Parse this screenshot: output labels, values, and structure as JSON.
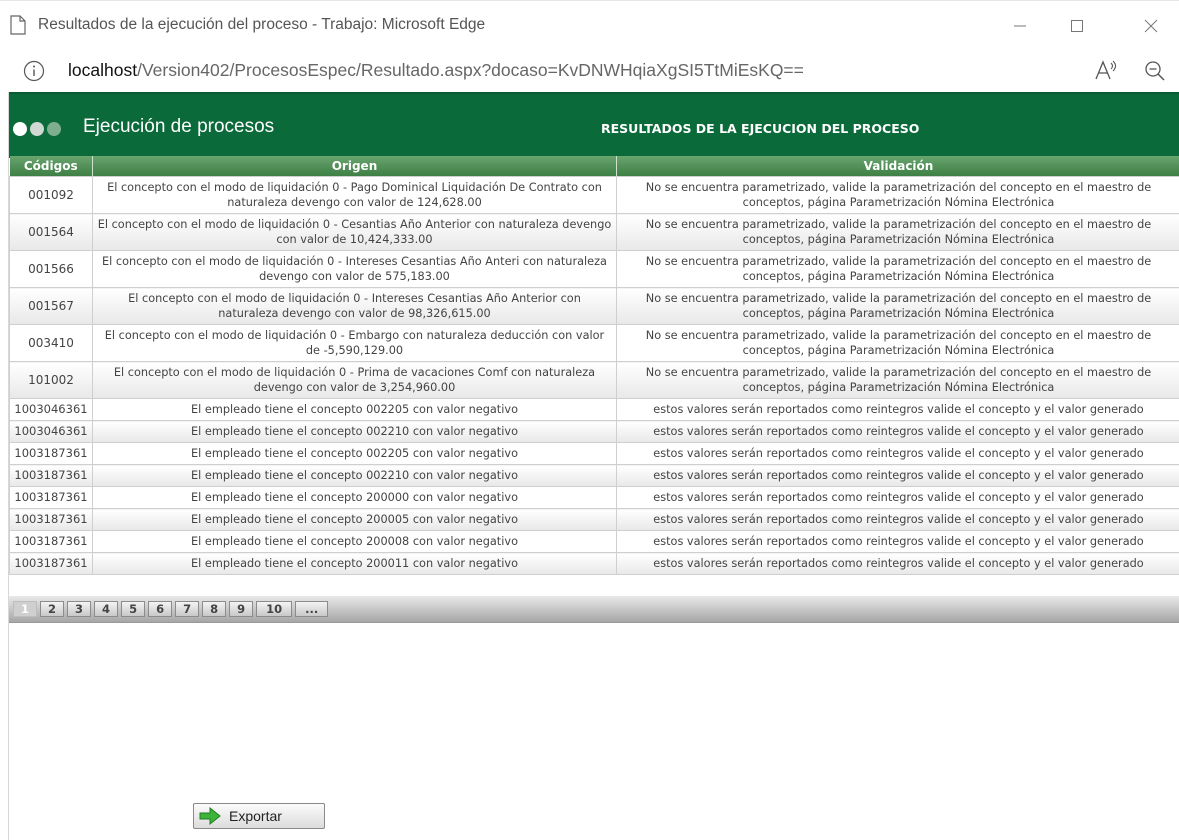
{
  "window": {
    "title": "Resultados de la ejecución del proceso - Trabajo: Microsoft Edge",
    "url_host": "localhost",
    "url_path": "/Version402/ProcesosEspec/Resultado.aspx?docaso=KvDNWHqiaXgSI5TtMiEsKQ=="
  },
  "icons": {
    "page": "page-icon",
    "minimize": "minimize-icon",
    "maximize": "maximize-icon",
    "close": "close-icon",
    "info": "info-icon",
    "read_aloud": "read-aloud-icon",
    "zoom_out": "zoom-out-icon",
    "export": "arrow-right-icon"
  },
  "colors": {
    "header_green": "#0a6a3a",
    "dot_1": "#ffffff",
    "dot_2": "#cfd8d2",
    "dot_3": "#7fae8f"
  },
  "header": {
    "brand": "Ejecución de procesos",
    "heading": "RESULTADOS DE LA EJECUCION DEL PROCESO"
  },
  "table": {
    "columns": [
      "Códigos",
      "Origen",
      "Validación"
    ],
    "rows": [
      {
        "code": "001092",
        "origen": "El concepto con el modo de liquidación 0 - Pago Dominical Liquidación De Contrato con naturaleza devengo con valor de 124,628.00",
        "validacion": "No se encuentra parametrizado, valide la parametrización del concepto en el maestro de conceptos, página Parametrización Nómina Electrónica"
      },
      {
        "code": "001564",
        "origen": "El concepto con el modo de liquidación 0 - Cesantias Año Anterior con naturaleza devengo con valor de 10,424,333.00",
        "validacion": "No se encuentra parametrizado, valide la parametrización del concepto en el maestro de conceptos, página Parametrización Nómina Electrónica"
      },
      {
        "code": "001566",
        "origen": "El concepto con el modo de liquidación 0 - Intereses Cesantias Año Anteri con naturaleza devengo con valor de 575,183.00",
        "validacion": "No se encuentra parametrizado, valide la parametrización del concepto en el maestro de conceptos, página Parametrización Nómina Electrónica"
      },
      {
        "code": "001567",
        "origen": "El concepto con el modo de liquidación 0 - Intereses Cesantias Año Anterior con naturaleza devengo con valor de 98,326,615.00",
        "validacion": "No se encuentra parametrizado, valide la parametrización del concepto en el maestro de conceptos, página Parametrización Nómina Electrónica"
      },
      {
        "code": "003410",
        "origen": "El concepto con el modo de liquidación 0 - Embargo con naturaleza deducción con valor de -5,590,129.00",
        "validacion": "No se encuentra parametrizado, valide la parametrización del concepto en el maestro de conceptos, página Parametrización Nómina Electrónica"
      },
      {
        "code": "101002",
        "origen": "El concepto con el modo de liquidación 0 - Prima de vacaciones Comf con naturaleza devengo con valor de 3,254,960.00",
        "validacion": "No se encuentra parametrizado, valide la parametrización del concepto en el maestro de conceptos, página Parametrización Nómina Electrónica"
      },
      {
        "code": "1003046361",
        "origen": "El empleado tiene el concepto 002205 con valor negativo",
        "validacion": "estos valores serán reportados como reintegros valide el concepto y el valor generado"
      },
      {
        "code": "1003046361",
        "origen": "El empleado tiene el concepto 002210 con valor negativo",
        "validacion": "estos valores serán reportados como reintegros valide el concepto y el valor generado"
      },
      {
        "code": "1003187361",
        "origen": "El empleado tiene el concepto 002205 con valor negativo",
        "validacion": "estos valores serán reportados como reintegros valide el concepto y el valor generado"
      },
      {
        "code": "1003187361",
        "origen": "El empleado tiene el concepto 002210 con valor negativo",
        "validacion": "estos valores serán reportados como reintegros valide el concepto y el valor generado"
      },
      {
        "code": "1003187361",
        "origen": "El empleado tiene el concepto 200000 con valor negativo",
        "validacion": "estos valores serán reportados como reintegros valide el concepto y el valor generado"
      },
      {
        "code": "1003187361",
        "origen": "El empleado tiene el concepto 200005 con valor negativo",
        "validacion": "estos valores serán reportados como reintegros valide el concepto y el valor generado"
      },
      {
        "code": "1003187361",
        "origen": "El empleado tiene el concepto 200008 con valor negativo",
        "validacion": "estos valores serán reportados como reintegros valide el concepto y el valor generado"
      },
      {
        "code": "1003187361",
        "origen": "El empleado tiene el concepto 200011 con valor negativo",
        "validacion": "estos valores serán reportados como reintegros valide el concepto y el valor generado"
      }
    ]
  },
  "pager": {
    "pages": [
      "1",
      "2",
      "3",
      "4",
      "5",
      "6",
      "7",
      "8",
      "9",
      "10",
      "..."
    ],
    "current": "1"
  },
  "export": {
    "label": "Exportar"
  }
}
